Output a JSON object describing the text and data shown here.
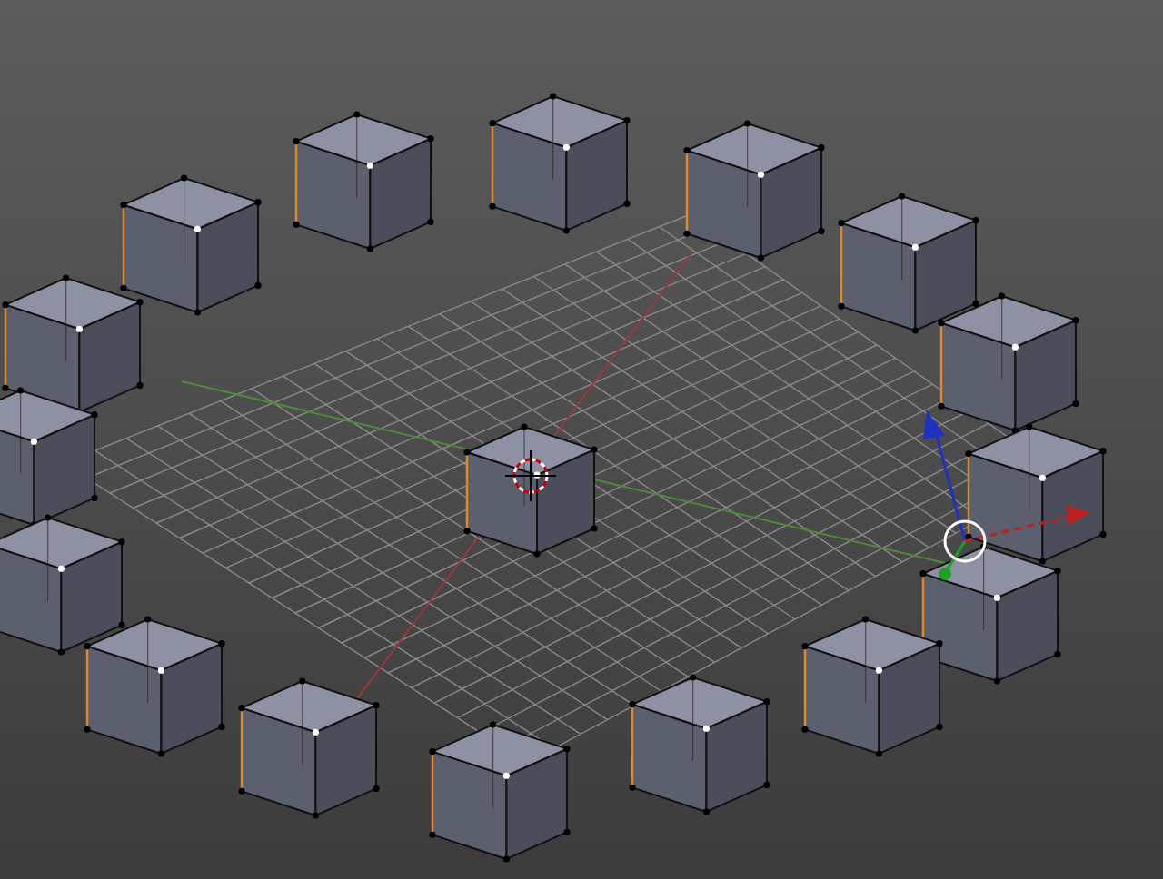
{
  "viewport": {
    "kind": "mesh-ring"
  }
}
